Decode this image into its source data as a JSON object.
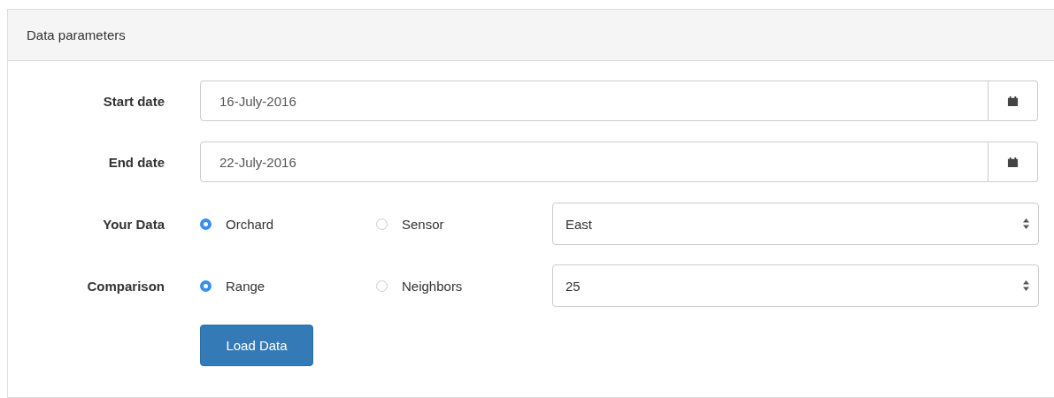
{
  "panel": {
    "title": "Data parameters"
  },
  "rows": [
    {
      "kind": "date",
      "label": "Start date",
      "value": "16-July-2016"
    },
    {
      "kind": "date",
      "label": "End date",
      "value": "22-July-2016"
    },
    {
      "kind": "choice",
      "label": "Your Data",
      "options": [
        {
          "label": "Orchard",
          "selected": true
        },
        {
          "label": "Sensor",
          "selected": false
        }
      ],
      "select": "East"
    },
    {
      "kind": "choice",
      "label": "Comparison",
      "options": [
        {
          "label": "Range",
          "selected": true
        },
        {
          "label": "Neighbors",
          "selected": false
        }
      ],
      "select": "25"
    }
  ],
  "button": "Load Data"
}
